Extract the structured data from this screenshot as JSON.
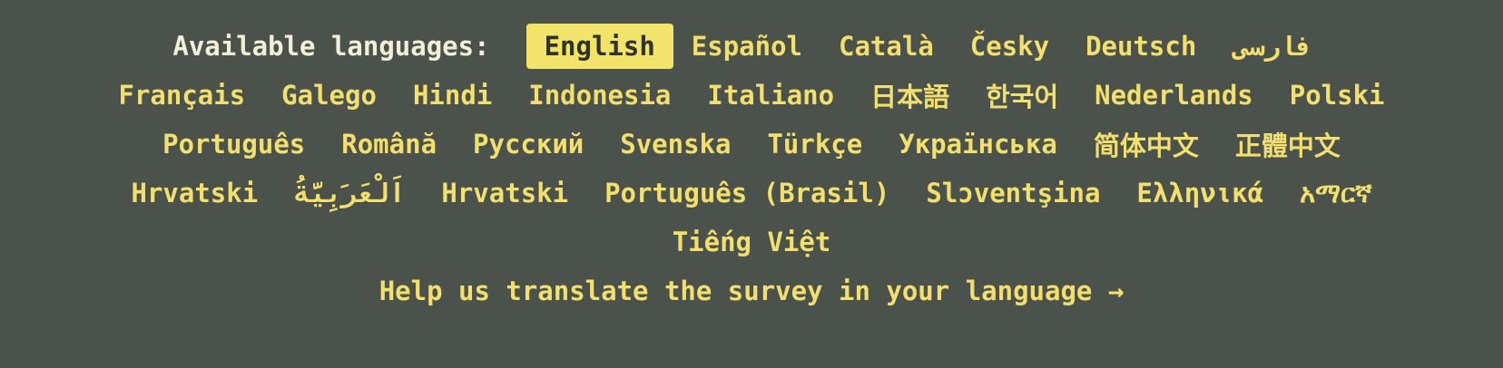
{
  "languages_label": "Available languages:",
  "active_language": "English",
  "rows": [
    [
      "Español",
      "Català",
      "Česky",
      "Deutsch",
      "فارسی"
    ],
    [
      "Français",
      "Galego",
      "Hindi",
      "Indonesia",
      "Italiano",
      "日本語",
      "한국어",
      "Nederlands",
      "Polski"
    ],
    [
      "Português",
      "Română",
      "Русский",
      "Svenska",
      "Türkçe",
      "Українська",
      "简体中文",
      "正體中文"
    ],
    [
      "Hrvatski",
      "اَلْعَرَبِيَّةُ",
      "Hrvatski",
      "Português (Brasil)",
      "Slɔventşina",
      "Ελληνικά",
      "አማርኛ"
    ],
    [
      "Tiếng Việt"
    ]
  ],
  "help_link": "Help us translate the survey in your language →",
  "colors": {
    "background": "#4a524b",
    "accent": "#f2df6d",
    "active_bg": "#f2e46b",
    "active_text": "#2f3328"
  }
}
